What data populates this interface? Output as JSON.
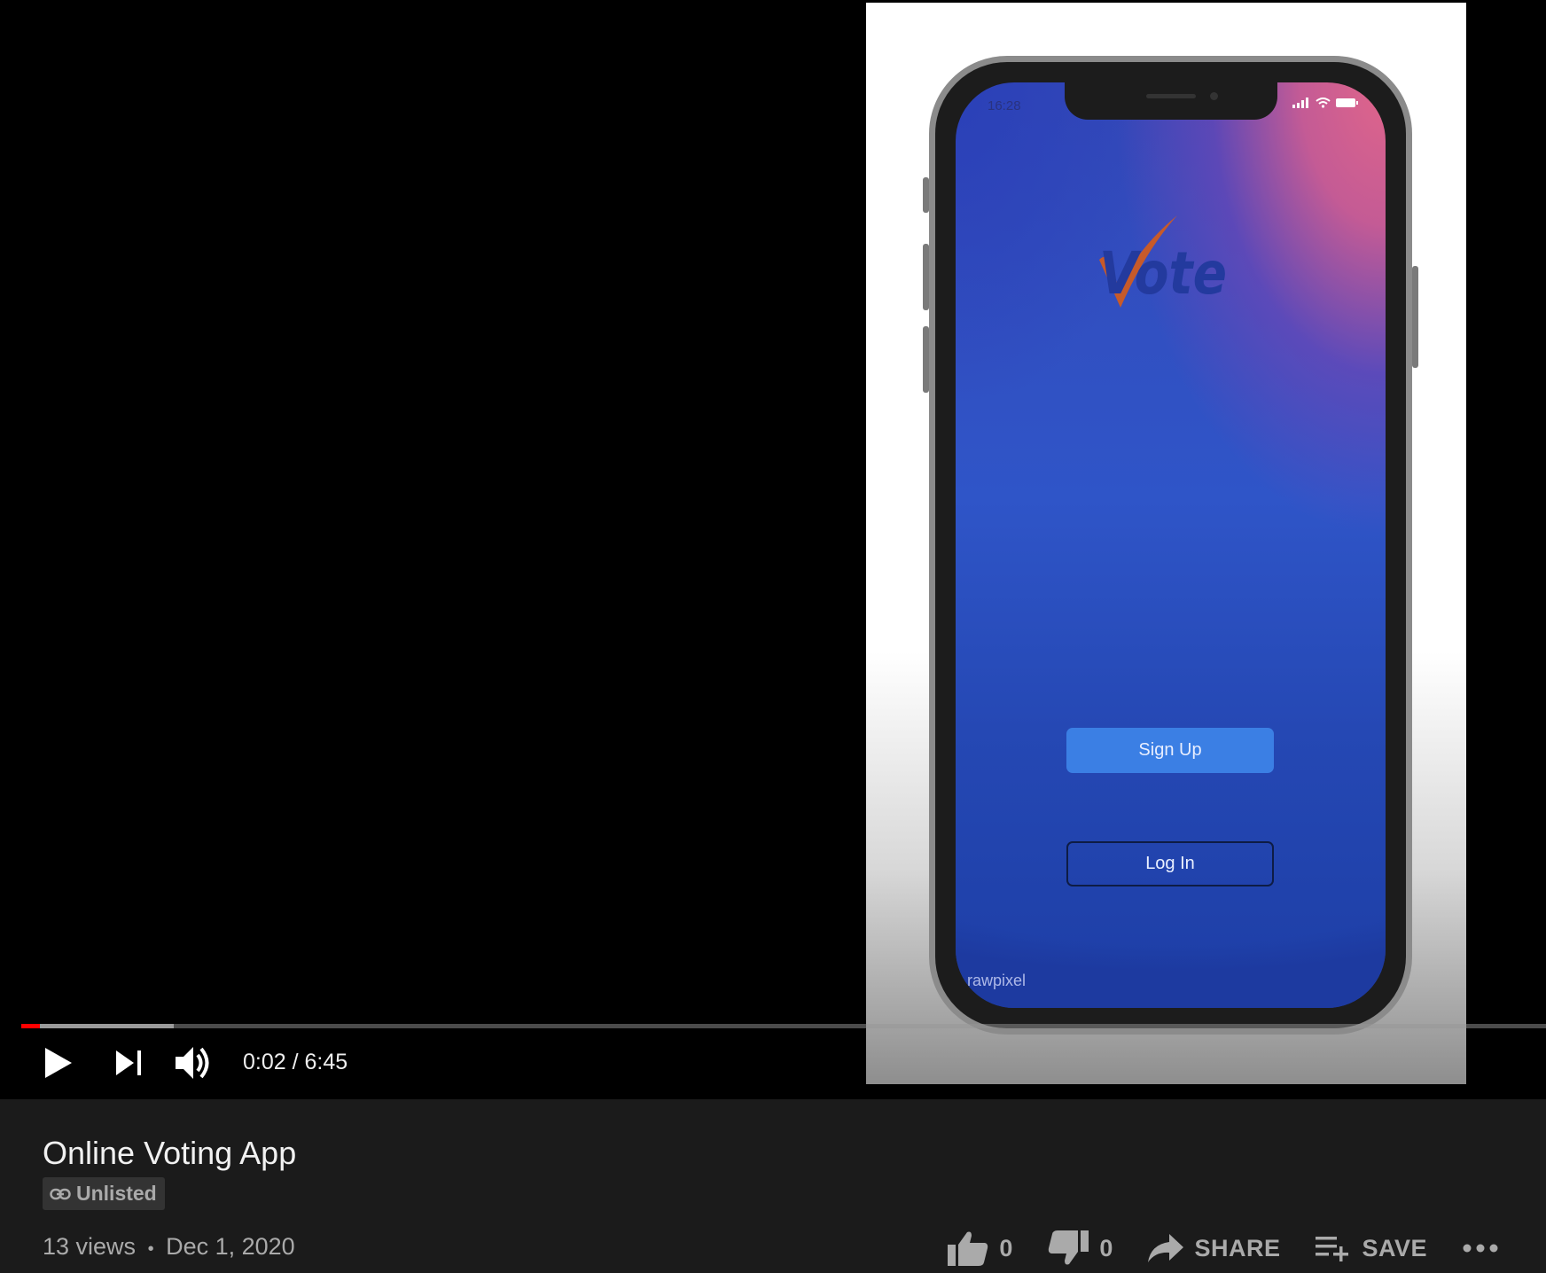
{
  "video": {
    "title": "Online Voting App",
    "visibility": "Unlisted",
    "views": "13 views",
    "separator": "•",
    "date": "Dec 1, 2020"
  },
  "player": {
    "time_display": "0:02 / 6:45",
    "played_fraction": 0.012,
    "buffered_fraction": 0.1,
    "progress_color": "#ff0000"
  },
  "app_preview": {
    "status_time": "16:28",
    "logo_text": "Vote",
    "signup_label": "Sign Up",
    "login_label": "Log In",
    "watermark": "rawpixel"
  },
  "actions": {
    "like_count": "0",
    "dislike_count": "0",
    "share_label": "SHARE",
    "save_label": "SAVE"
  },
  "icons": [
    "play-icon",
    "next-icon",
    "volume-icon",
    "link-icon",
    "thumbs-up-icon",
    "thumbs-down-icon",
    "share-icon",
    "playlist-add-icon",
    "more-icon"
  ]
}
